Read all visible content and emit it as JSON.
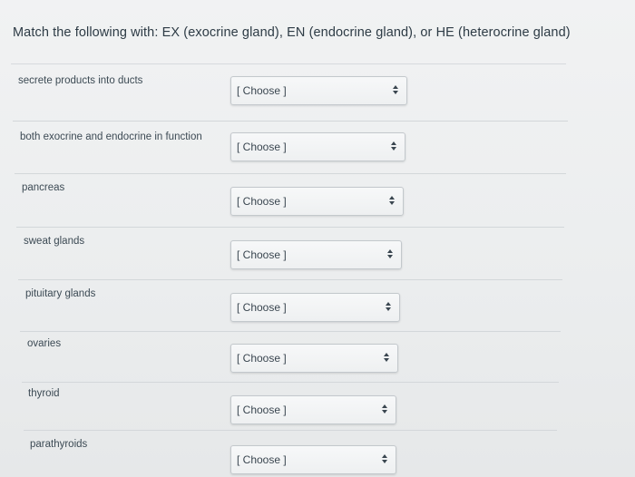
{
  "question": {
    "text": "Match the following with: EX (exocrine gland), EN (endocrine gland), or HE (heterocrine gland)"
  },
  "items": [
    {
      "prompt": "secrete products into ducts",
      "selected": "[ Choose ]"
    },
    {
      "prompt": "both exocrine and endocrine in function",
      "selected": "[ Choose ]"
    },
    {
      "prompt": "pancreas",
      "selected": "[ Choose ]"
    },
    {
      "prompt": "sweat glands",
      "selected": "[ Choose ]"
    },
    {
      "prompt": "pituitary glands",
      "selected": "[ Choose ]"
    },
    {
      "prompt": "ovaries",
      "selected": "[ Choose ]"
    },
    {
      "prompt": "thyroid",
      "selected": "[ Choose ]"
    },
    {
      "prompt": "parathyroids",
      "selected": "[ Choose ]"
    }
  ],
  "icons": {
    "select_arrow": "up-down-caret-icon"
  }
}
